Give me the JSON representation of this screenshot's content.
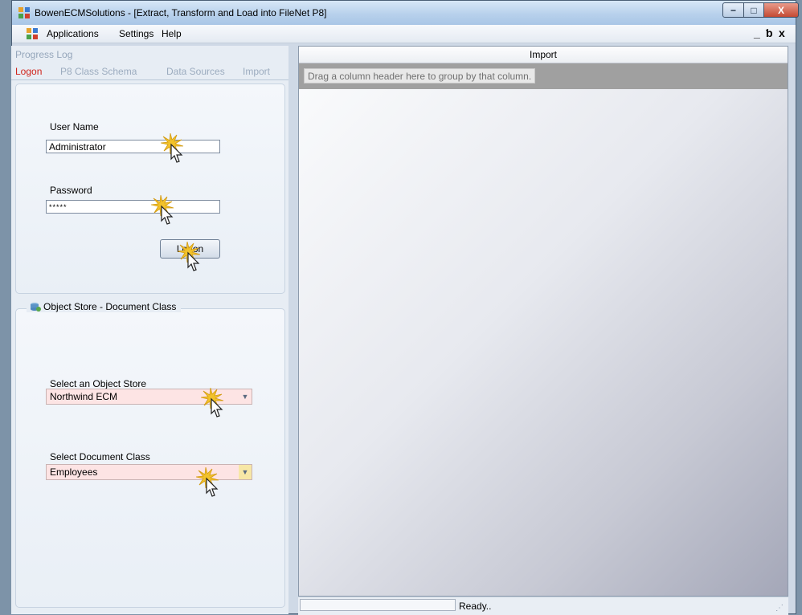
{
  "window": {
    "title": "BowenECMSolutions - [Extract, Transform and Load into FileNet P8]",
    "minimize_symbol": "−",
    "maximize_symbol": "□",
    "close_symbol": "X"
  },
  "menubar": {
    "items": [
      "Applications",
      "Settings",
      "Help"
    ],
    "mdi_minimize": "_",
    "mdi_restore": "ƅ",
    "mdi_close": "x"
  },
  "left_panel": {
    "progress_log_label": "Progress Log",
    "tabs": [
      {
        "label": "Logon",
        "active": true
      },
      {
        "label": "P8 Class Schema",
        "active": false
      },
      {
        "label": "Data Sources",
        "active": false
      },
      {
        "label": "Import",
        "active": false
      }
    ],
    "logon": {
      "user_name_label": "User Name",
      "user_name_value": "Administrator",
      "password_label": "Password",
      "password_value": "*****",
      "logon_button": "Logon"
    },
    "object_store_group": {
      "title": "Object Store - Document Class",
      "select_object_store_label": "Select an Object Store",
      "object_store_value": "Northwind ECM",
      "select_document_class_label": "Select Document Class",
      "document_class_value": "Employees"
    }
  },
  "right_panel": {
    "header": "Import",
    "group_by_hint": "Drag a column header here to group by that column."
  },
  "statusbar": {
    "status_text": "Ready..",
    "grip": "⋰"
  },
  "colors": {
    "active_tab": "#d0241b",
    "inactive_tab": "#9cacbf",
    "combo_background": "#fde4e4",
    "cursor_burst": "#f2c22b"
  }
}
